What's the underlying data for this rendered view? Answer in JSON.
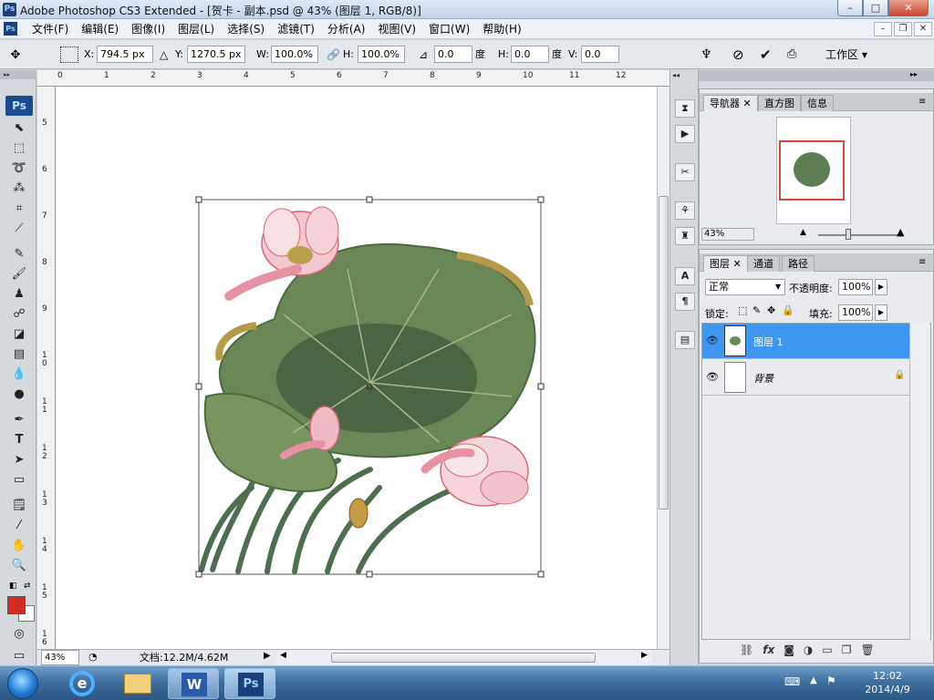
{
  "window": {
    "logo": "Ps",
    "title": "Adobe Photoshop CS3 Extended - [贺卡 - 副本.psd @ 43% (图层 1, RGB/8)]",
    "min": "–",
    "max": "□",
    "close": "✕"
  },
  "menu": {
    "items": [
      "文件(F)",
      "编辑(E)",
      "图像(I)",
      "图层(L)",
      "选择(S)",
      "滤镜(T)",
      "分析(A)",
      "视图(V)",
      "窗口(W)",
      "帮助(H)"
    ],
    "mdi": [
      "–",
      "❐",
      "✕"
    ]
  },
  "options": {
    "x_label": "X:",
    "x_value": "794.5 px",
    "y_label": "Y:",
    "y_value": "1270.5 px",
    "w_label": "W:",
    "w_value": "100.0%",
    "h_label": "H:",
    "h_value": "100.0%",
    "rot_value": "0.0",
    "rot_unit": "度",
    "hskew_label": "H:",
    "hskew_value": "0.0",
    "hskew_unit": "度",
    "vskew_label": "V:",
    "vskew_value": "0.0",
    "workspace": "工作区 ▾"
  },
  "ruler": {
    "top": [
      "0",
      "1",
      "2",
      "3",
      "4",
      "5",
      "6",
      "7",
      "8",
      "9",
      "10",
      "11",
      "12"
    ],
    "left": [
      "5",
      "6",
      "7",
      "8",
      "9",
      "1\n0",
      "1\n1",
      "1\n2",
      "1\n3",
      "1\n4",
      "1\n5",
      "1\n6"
    ]
  },
  "status": {
    "zoom": "43%",
    "doc": "文档:12.2M/4.62M"
  },
  "navigator": {
    "tabs": [
      "导航器",
      "直方图",
      "信息"
    ],
    "zoom": "43%"
  },
  "layers": {
    "tabs": [
      "图层",
      "通道",
      "路径"
    ],
    "blend_mode": "正常",
    "opacity_label": "不透明度:",
    "opacity_value": "100%",
    "lock_label": "锁定:",
    "fill_label": "填充:",
    "fill_value": "100%",
    "items": [
      {
        "name": "图层 1",
        "selected": true
      },
      {
        "name": "背景",
        "selected": false,
        "locked": true
      }
    ]
  },
  "taskbar": {
    "time": "12:02",
    "date": "2014/4/9"
  },
  "colors": {
    "foreground": "#d62a23",
    "background": "#ffffff",
    "selection": "#3d97f0"
  }
}
